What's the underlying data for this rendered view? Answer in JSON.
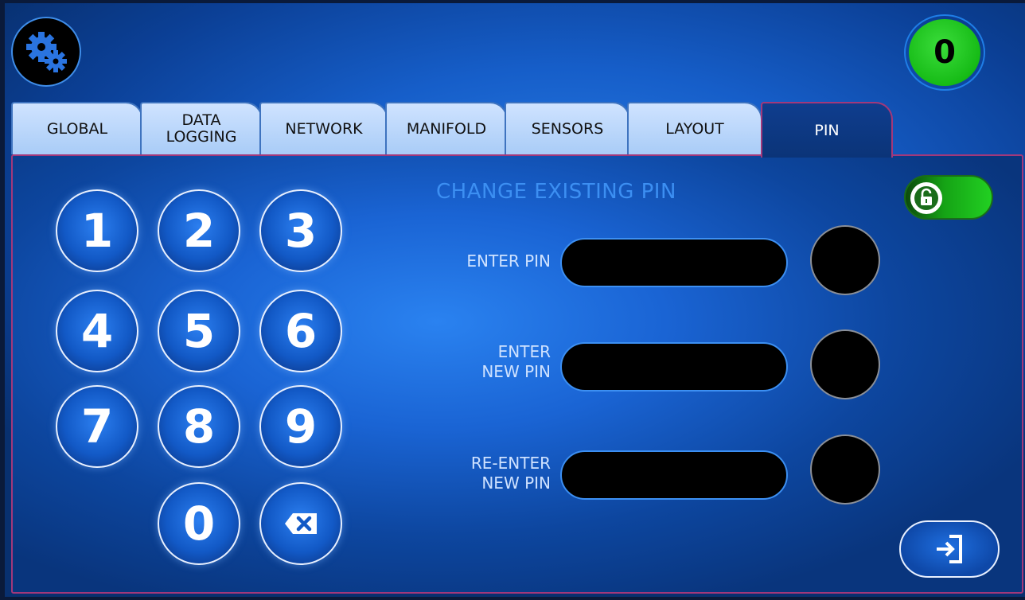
{
  "header": {
    "settings_icon": "gears-icon",
    "alert_count": "0"
  },
  "tabs": [
    {
      "label": "GLOBAL"
    },
    {
      "label": "DATA\nLOGGING"
    },
    {
      "label": "NETWORK"
    },
    {
      "label": "MANIFOLD"
    },
    {
      "label": "SENSORS"
    },
    {
      "label": "LAYOUT"
    },
    {
      "label": "PIN",
      "active": true
    }
  ],
  "keypad": {
    "keys": [
      "1",
      "2",
      "3",
      "4",
      "5",
      "6",
      "7",
      "8",
      "9",
      "0"
    ],
    "backspace_icon": "backspace-icon"
  },
  "pin_form": {
    "title": "CHANGE EXISTING PIN",
    "fields": [
      {
        "label": "ENTER PIN",
        "value": ""
      },
      {
        "label": "ENTER\nNEW PIN",
        "value": ""
      },
      {
        "label": "RE-ENTER\nNEW PIN",
        "value": ""
      }
    ]
  },
  "lock_toggle": {
    "state": "unlocked",
    "icon": "unlocked-padlock-icon"
  },
  "exit_button": {
    "icon": "exit-icon"
  },
  "colors": {
    "accent_blue": "#3c8ff2",
    "active_tab_border": "#a3387a",
    "badge_green": "#16bb16",
    "toggle_green": "#22d022"
  }
}
